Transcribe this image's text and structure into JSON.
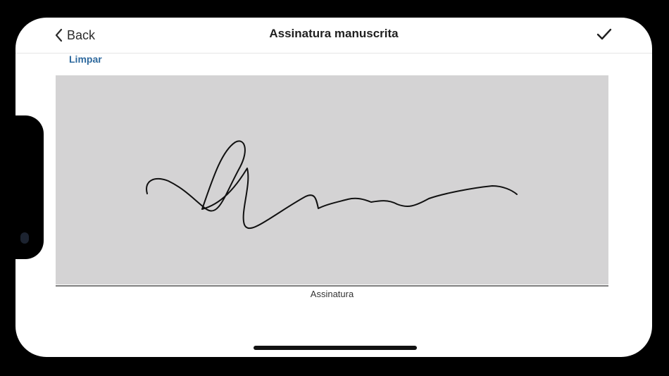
{
  "navbar": {
    "back_label": "Back",
    "title": "Assinatura manuscrita",
    "done_icon": "checkmark-icon"
  },
  "actions": {
    "clear_label": "Limpar"
  },
  "signature": {
    "pad_color": "#d4d3d4",
    "label": "Assinatura"
  },
  "colors": {
    "link": "#2f6a9e"
  }
}
